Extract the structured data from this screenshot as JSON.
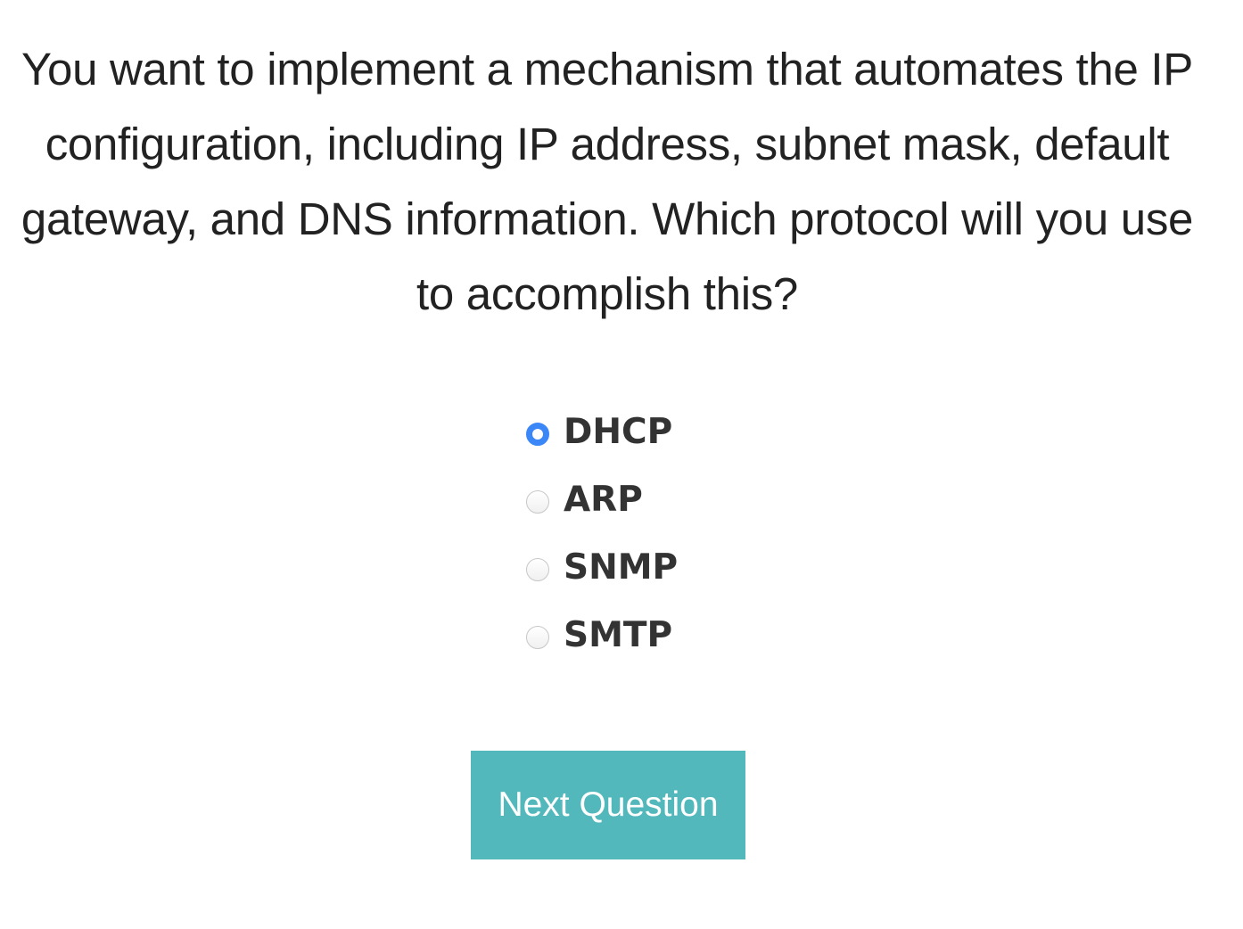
{
  "question": "You want to implement a mechanism that automates the IP configuration, including IP address, subnet mask, default gateway, and DNS information. Which protocol will you use to accomplish this?",
  "options": [
    {
      "label": "DHCP",
      "selected": true
    },
    {
      "label": "ARP",
      "selected": false
    },
    {
      "label": "SNMP",
      "selected": false
    },
    {
      "label": "SMTP",
      "selected": false
    }
  ],
  "next_button": "Next Question",
  "colors": {
    "accent": "#52b8bb",
    "radio_selected": "#3b87f7"
  }
}
